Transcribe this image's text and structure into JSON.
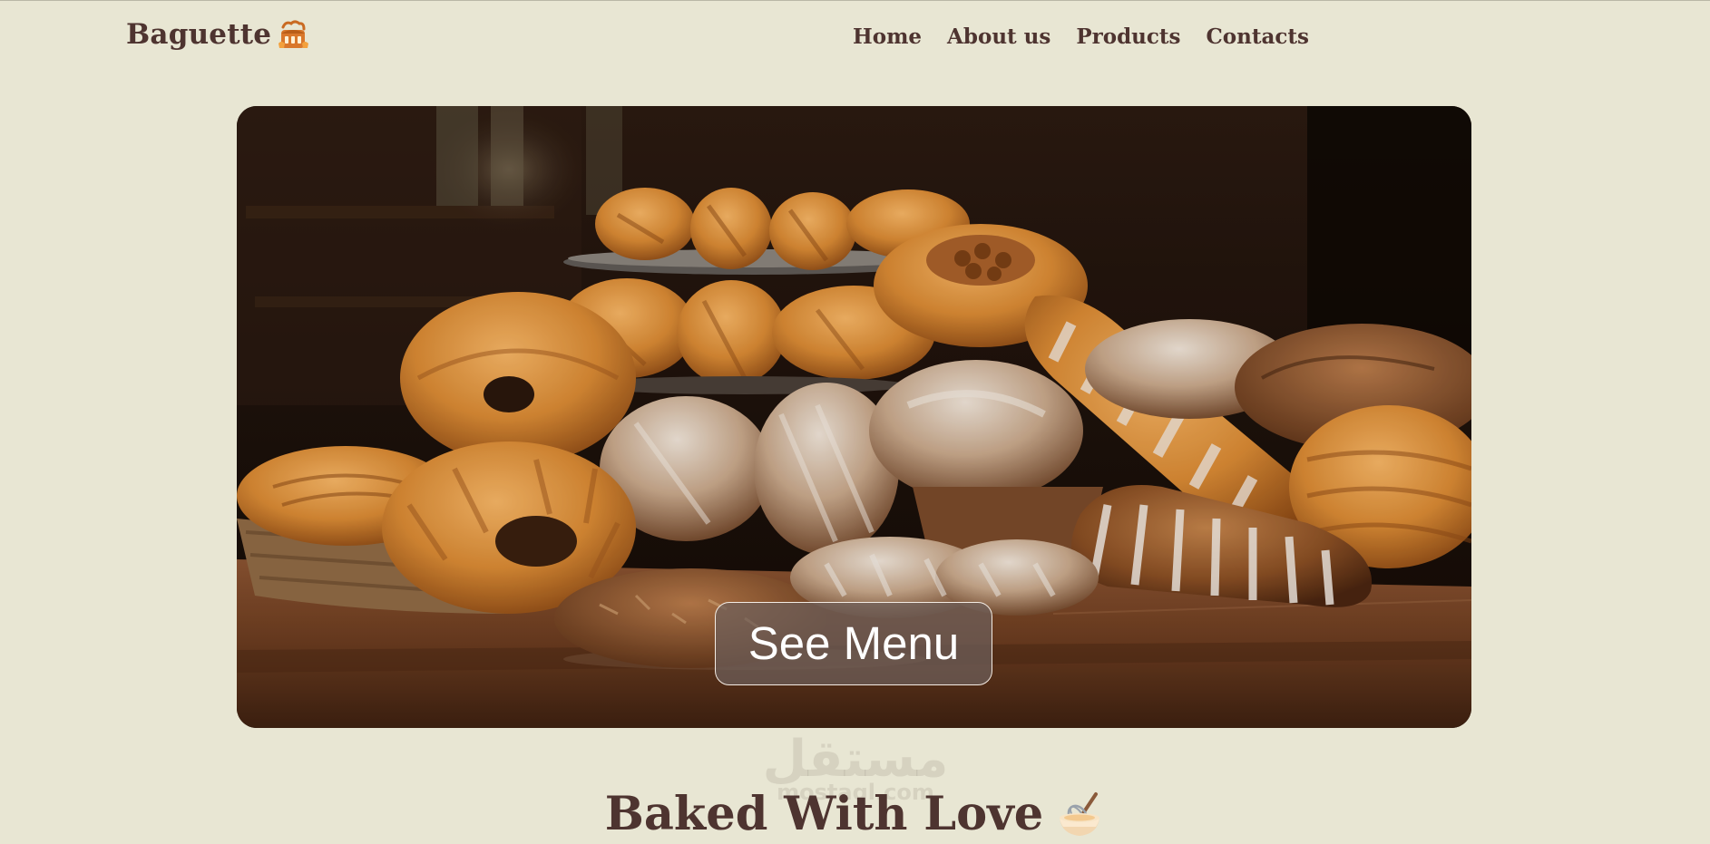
{
  "header": {
    "brand": "Baguette",
    "brand_icon": "bakery-basket-icon",
    "nav": [
      {
        "label": "Home"
      },
      {
        "label": "About us"
      },
      {
        "label": "Products"
      },
      {
        "label": "Contacts"
      }
    ]
  },
  "hero": {
    "image": "bakery-bread-photo",
    "button_label": "See Menu"
  },
  "watermark": {
    "text": "مستقل",
    "sub": "mostaql.com"
  },
  "section": {
    "heading": "Baked With Love",
    "heading_icon": "mixing-bowl-whisk-icon"
  },
  "colors": {
    "background": "#e8e6d3",
    "text": "#4e3430",
    "button_border": "#f4ece4"
  }
}
